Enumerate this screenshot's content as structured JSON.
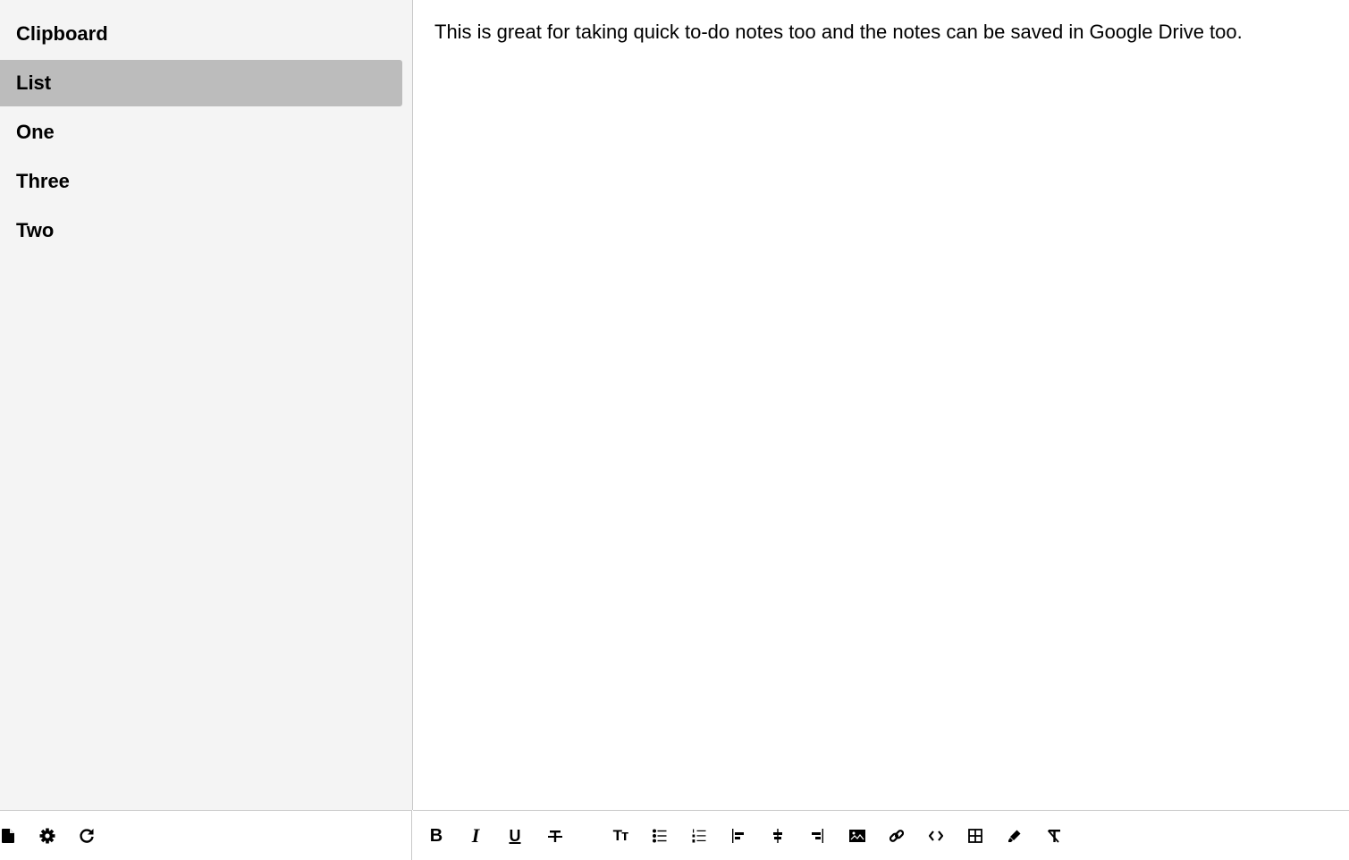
{
  "sidebar": {
    "notes": [
      {
        "label": "Clipboard",
        "active": false
      },
      {
        "label": "List",
        "active": true
      },
      {
        "label": "One",
        "active": false
      },
      {
        "label": "Three",
        "active": false
      },
      {
        "label": "Two",
        "active": false
      }
    ],
    "footer_icons": [
      "new-note-icon",
      "settings-icon",
      "refresh-icon"
    ]
  },
  "editor": {
    "content": "This is great for taking quick to-do notes too and the notes can be saved in Google Drive too."
  },
  "toolbar": {
    "bold_glyph": "B",
    "italic_glyph": "I",
    "underline_glyph": "U",
    "font_size_glyph": "Tт",
    "buttons": [
      "bold",
      "italic",
      "underline",
      "strikethrough",
      "font-size",
      "bullet-list",
      "numbered-list",
      "align-left",
      "align-center",
      "align-right",
      "image",
      "link",
      "code",
      "table",
      "highlight",
      "clear-formatting"
    ]
  },
  "colors": {
    "sidebar_bg": "#f4f4f4",
    "active_item_bg": "#bcbcbc",
    "border": "#c9c9c9"
  }
}
